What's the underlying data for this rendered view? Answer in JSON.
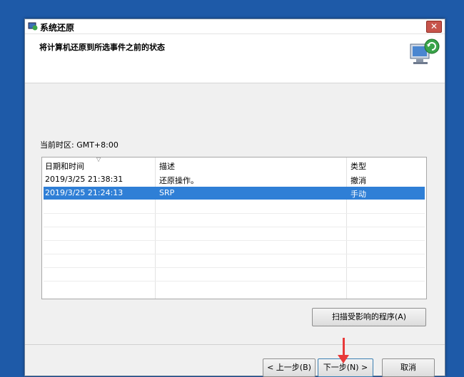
{
  "window": {
    "title": "系统还原",
    "close_label": "✕"
  },
  "header": {
    "heading": "将计算机还原到所选事件之前的状态"
  },
  "timezone": {
    "label": "当前时区: GMT+8:00"
  },
  "table": {
    "columns": [
      "日期和时间",
      "描述",
      "类型"
    ],
    "rows": [
      {
        "date": "2019/3/25 21:38:31",
        "desc": "还原操作。",
        "type": "撤消",
        "selected": false
      },
      {
        "date": "2019/3/25 21:24:13",
        "desc": "SRP",
        "type": "手动",
        "selected": true
      }
    ]
  },
  "buttons": {
    "scan": "扫描受影响的程序(A)",
    "back": "< 上一步(B)",
    "next": "下一步(N) >",
    "cancel": "取消"
  },
  "colors": {
    "selection": "#2f7fd6",
    "desktop": "#1e5aa8",
    "annotation_arrow": "#e83a3a"
  }
}
